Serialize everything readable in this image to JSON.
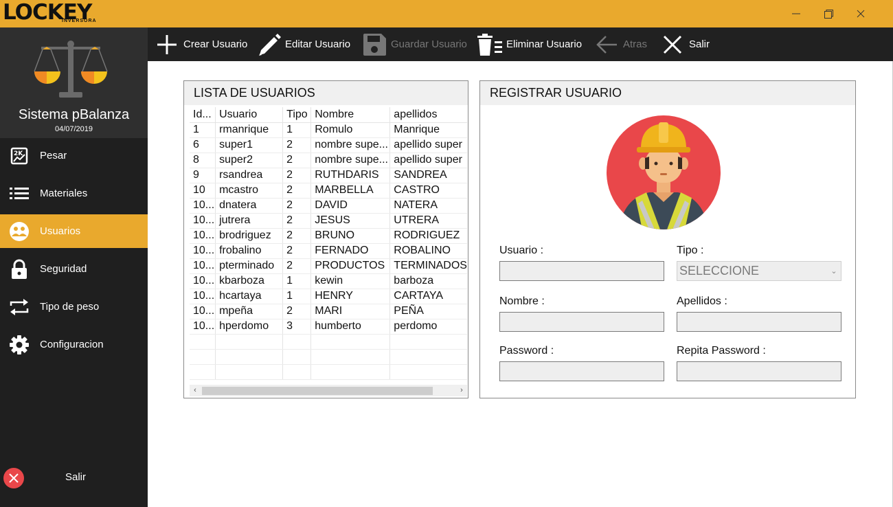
{
  "brand": {
    "logo_word": "LOCKEY",
    "logo_sub": "INVERSORA"
  },
  "window": {
    "minimize": "minimize",
    "maximize": "maximize",
    "close": "close"
  },
  "sidebar": {
    "app_title": "Sistema pBalanza",
    "date": "04/07/2019",
    "items": [
      {
        "label": "Pesar",
        "icon": "scale-chart-icon"
      },
      {
        "label": "Materiales",
        "icon": "list-icon"
      },
      {
        "label": "Usuarios",
        "icon": "users-icon",
        "active": true
      },
      {
        "label": "Seguridad",
        "icon": "lock-icon"
      },
      {
        "label": "Tipo de peso",
        "icon": "swap-icon"
      },
      {
        "label": "Configuracion",
        "icon": "gear-icon"
      }
    ],
    "exit_label": "Salir"
  },
  "toolbar": {
    "crear": "Crear Usuario",
    "editar": "Editar Usuario",
    "guardar": "Guardar Usuario",
    "eliminar": "Eliminar Usuario",
    "atras": "Atras",
    "salir": "Salir"
  },
  "user_list": {
    "title": "LISTA DE USUARIOS",
    "columns": [
      "Id...",
      "Usuario",
      "Tipo",
      "Nombre",
      "apellidos"
    ],
    "rows": [
      [
        "1",
        "rmanrique",
        "1",
        "Romulo",
        "Manrique"
      ],
      [
        "6",
        "super1",
        "2",
        "nombre supe...",
        "apellido super"
      ],
      [
        "8",
        "super2",
        "2",
        "nombre supe...",
        "apellido super"
      ],
      [
        "9",
        "rsandrea",
        "2",
        "RUTHDARIS",
        "SANDREA"
      ],
      [
        "10",
        "mcastro",
        "2",
        "MARBELLA",
        "CASTRO"
      ],
      [
        "10...",
        "dnatera",
        "2",
        "DAVID",
        "NATERA"
      ],
      [
        "10...",
        "jutrera",
        "2",
        "JESUS",
        "UTRERA"
      ],
      [
        "10...",
        "brodriguez",
        "2",
        "BRUNO",
        "RODRIGUEZ"
      ],
      [
        "10...",
        "frobalino",
        "2",
        "FERNADO",
        "ROBALINO"
      ],
      [
        "10...",
        "pterminado",
        "2",
        "PRODUCTOS",
        "TERMINADOS"
      ],
      [
        "10...",
        "kbarboza",
        "1",
        "kewin",
        "barboza"
      ],
      [
        "10...",
        "hcartaya",
        "1",
        "HENRY",
        "CARTAYA"
      ],
      [
        "10...",
        "mpeña",
        "2",
        "MARI",
        "PEÑA"
      ],
      [
        "10...",
        "hperdomo",
        "3",
        "humberto",
        "perdomo"
      ]
    ]
  },
  "register": {
    "title": "REGISTRAR USUARIO",
    "usuario_label": "Usuario   :",
    "tipo_label": "Tipo    :",
    "tipo_value": "SELECCIONE",
    "nombre_label": "Nombre   :",
    "apellidos_label": "Apellidos   :",
    "password_label": "Password   :",
    "repita_label": "Repita Password   :"
  },
  "colors": {
    "accent": "#e9a92d",
    "sidebar": "#1f1f1f",
    "toolbar": "#212121",
    "avatar_bg": "#e9474a"
  }
}
